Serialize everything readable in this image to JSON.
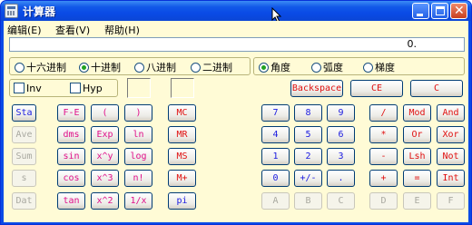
{
  "window": {
    "title": "计算器"
  },
  "menu": [
    {
      "label": "编辑(E)"
    },
    {
      "label": "查看(V)"
    },
    {
      "label": "帮助(H)"
    }
  ],
  "display": {
    "value": "0."
  },
  "base_radios": [
    {
      "label": "十六进制",
      "selected": false
    },
    {
      "label": "十进制",
      "selected": true
    },
    {
      "label": "八进制",
      "selected": false
    },
    {
      "label": "二进制",
      "selected": false
    }
  ],
  "angle_radios": [
    {
      "label": "角度",
      "selected": true
    },
    {
      "label": "弧度",
      "selected": false
    },
    {
      "label": "梯度",
      "selected": false
    }
  ],
  "checkboxes": [
    {
      "label": "Inv",
      "checked": false
    },
    {
      "label": "Hyp",
      "checked": false
    }
  ],
  "edit_buttons": [
    {
      "label": "Backspace",
      "color": "#e01010"
    },
    {
      "label": "CE",
      "color": "#e01010"
    },
    {
      "label": "C",
      "color": "#e01010"
    }
  ],
  "left_col": [
    {
      "label": "Sta",
      "enabled": true,
      "color": "#1a1ae0"
    },
    {
      "label": "Ave",
      "enabled": false
    },
    {
      "label": "Sum",
      "enabled": false
    },
    {
      "label": "s",
      "enabled": false
    },
    {
      "label": "Dat",
      "enabled": false
    }
  ],
  "func_grid": [
    [
      {
        "label": "F-E"
      },
      {
        "label": "("
      },
      {
        "label": ")"
      }
    ],
    [
      {
        "label": "dms"
      },
      {
        "label": "Exp"
      },
      {
        "label": "ln"
      }
    ],
    [
      {
        "label": "sin"
      },
      {
        "label": "x^y"
      },
      {
        "label": "log"
      }
    ],
    [
      {
        "label": "cos"
      },
      {
        "label": "x^3"
      },
      {
        "label": "n!"
      }
    ],
    [
      {
        "label": "tan"
      },
      {
        "label": "x^2"
      },
      {
        "label": "1/x"
      }
    ]
  ],
  "memory_col": [
    {
      "label": "MC",
      "color": "#e01010"
    },
    {
      "label": "MR",
      "color": "#e01010"
    },
    {
      "label": "MS",
      "color": "#e01010"
    },
    {
      "label": "M+",
      "color": "#e01010"
    },
    {
      "label": "pi",
      "color": "#1a1ae0"
    }
  ],
  "num_grid": [
    [
      {
        "label": "7",
        "color": "#1a1ae0"
      },
      {
        "label": "8",
        "color": "#1a1ae0"
      },
      {
        "label": "9",
        "color": "#1a1ae0"
      },
      {
        "label": "/",
        "color": "#e01010"
      },
      {
        "label": "Mod",
        "color": "#e01010"
      },
      {
        "label": "And",
        "color": "#e01010"
      }
    ],
    [
      {
        "label": "4",
        "color": "#1a1ae0"
      },
      {
        "label": "5",
        "color": "#1a1ae0"
      },
      {
        "label": "6",
        "color": "#1a1ae0"
      },
      {
        "label": "*",
        "color": "#e01010"
      },
      {
        "label": "Or",
        "color": "#e01010"
      },
      {
        "label": "Xor",
        "color": "#e01010"
      }
    ],
    [
      {
        "label": "1",
        "color": "#1a1ae0"
      },
      {
        "label": "2",
        "color": "#1a1ae0"
      },
      {
        "label": "3",
        "color": "#1a1ae0"
      },
      {
        "label": "-",
        "color": "#e01010"
      },
      {
        "label": "Lsh",
        "color": "#e01010"
      },
      {
        "label": "Not",
        "color": "#e01010"
      }
    ],
    [
      {
        "label": "0",
        "color": "#1a1ae0"
      },
      {
        "label": "+/-",
        "color": "#1a1ae0"
      },
      {
        "label": ".",
        "color": "#1a1ae0"
      },
      {
        "label": "+",
        "color": "#e01010"
      },
      {
        "label": "=",
        "color": "#e01010"
      },
      {
        "label": "Int",
        "color": "#e01010"
      }
    ],
    [
      {
        "label": "A",
        "enabled": false
      },
      {
        "label": "B",
        "enabled": false
      },
      {
        "label": "C",
        "enabled": false
      },
      {
        "label": "D",
        "enabled": false
      },
      {
        "label": "E",
        "enabled": false
      },
      {
        "label": "F",
        "enabled": false
      }
    ]
  ]
}
